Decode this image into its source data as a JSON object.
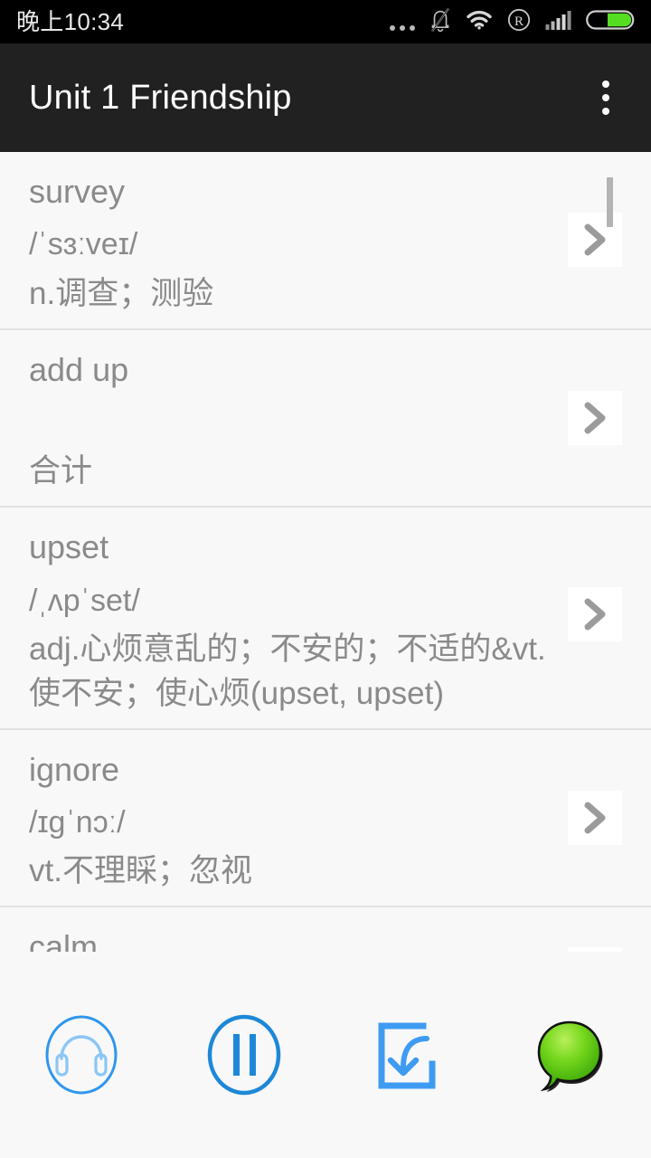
{
  "status_bar": {
    "clock": "晚上10:34",
    "icons": [
      {
        "name": "more-dots-icon",
        "glyph": "…"
      },
      {
        "name": "bell-muted-icon",
        "glyph": "bell-slash"
      },
      {
        "name": "wifi-icon",
        "glyph": "wifi"
      },
      {
        "name": "roaming-icon",
        "glyph": "R"
      },
      {
        "name": "signal-bars-icon",
        "glyph": "signal"
      },
      {
        "name": "battery-icon",
        "glyph": "battery"
      }
    ],
    "colors": {
      "background": "#000000",
      "text": "#e8e8e8",
      "icon": "#b9b9b9",
      "battery_fill": "#55dd22"
    }
  },
  "action_bar": {
    "title": "Unit 1 Friendship",
    "overflow_label": "更多",
    "background": "#212121",
    "text_color": "#ffffff"
  },
  "list": {
    "chevron_label": "›",
    "items": [
      {
        "headword": "survey",
        "phonetic": "/ˈsɜːveɪ/",
        "meaning": "n.调查；测验"
      },
      {
        "headword": "add up",
        "phonetic": "",
        "meaning": "合计"
      },
      {
        "headword": "upset",
        "phonetic": "/ˌʌpˈset/",
        "meaning": "adj.心烦意乱的；不安的；不适的&vt.使不安；使心烦(upset, upset)"
      },
      {
        "headword": "ignore",
        "phonetic": "/ɪgˈnɔː/",
        "meaning": "vt.不理睬；忽视"
      },
      {
        "headword": "calm",
        "phonetic": "",
        "meaning": ""
      }
    ],
    "colors": {
      "background": "#f8f8f8",
      "text": "#8a8a8a",
      "divider": "#e2e2e2",
      "chevron": "#9b9b9b",
      "chevron_bg": "#ffffff",
      "scrollbar": "#b3b3b3"
    }
  },
  "bottom_bar": {
    "buttons": [
      {
        "name": "headphones-button",
        "label": "听音"
      },
      {
        "name": "pause-button",
        "label": "暂停"
      },
      {
        "name": "import-button",
        "label": "导入"
      },
      {
        "name": "chat-button",
        "label": "聊天"
      }
    ],
    "colors": {
      "accent": "#1e88d8",
      "accent_light": "#59a8f0",
      "balloon": "#55cc11",
      "background": "#f8f8f8"
    }
  }
}
